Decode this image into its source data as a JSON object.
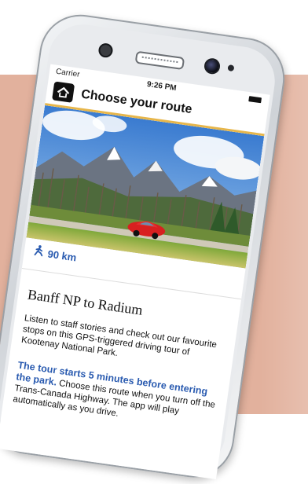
{
  "status_bar": {
    "carrier": "Carrier",
    "time": "9:26 PM"
  },
  "header": {
    "title": "Choose your route",
    "accent_color": "#e7b64a"
  },
  "hero": {
    "icon": "car-icon",
    "car_color": "#d82020"
  },
  "route": {
    "distance": "90 km",
    "distance_icon": "hiker-icon",
    "name": "Banff NP to Radium",
    "description": "Listen to staff stories and check out our favourite stops on this GPS-triggered driving tour of Kootenay National Park.",
    "note_emphasis": "The tour starts 5 minutes before entering the park.",
    "note_body": " Choose this route when you turn off the Trans-Canada Highway. The app will play automatically as you drive."
  },
  "colors": {
    "background_panel": "#e2b19d",
    "link_blue": "#2a5bb0"
  }
}
